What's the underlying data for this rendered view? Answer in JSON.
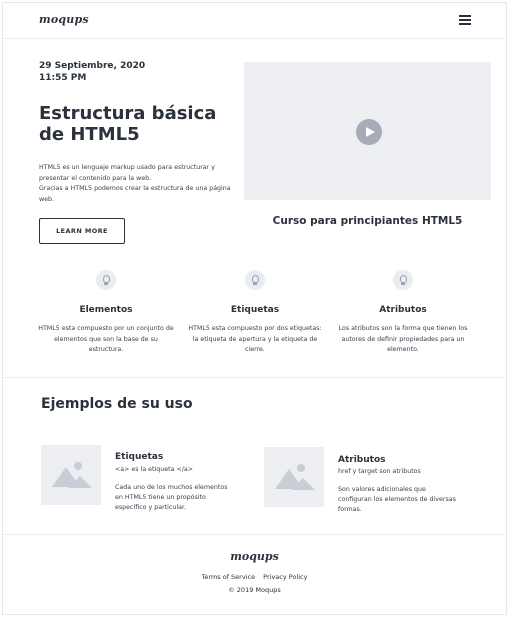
{
  "header": {
    "logo": "moqups",
    "menu_icon": "hamburger-icon"
  },
  "hero": {
    "date": "29 Septiembre, 2020",
    "time": "11:55 PM",
    "title": "Estructura básica de HTML5",
    "text_1": "HTML5 es un lenguaje markup usado para estructurar y presentar el contenido para la web.",
    "text_2": "Gracias a HTML5 podemos crear la estructura de una página web.",
    "button_label": "LEARN MORE"
  },
  "video": {
    "play_icon": "play-icon",
    "caption": "Curso para principiantes HTML5"
  },
  "features": [
    {
      "icon": "lightbulb-icon",
      "title": "Elementos",
      "text": "HTML5 esta compuesto por un conjunto de elementos que son la base de su estructura."
    },
    {
      "icon": "lightbulb-icon",
      "title": "Etiquetas",
      "text": "HTML5 esta compuesto por dos etiquetas: la etiqueta de apertura y la etiqueta de cierre."
    },
    {
      "icon": "lightbulb-icon",
      "title": "Atributos",
      "text": "Los atributos son la forma que tienen los autores de definir propiedades para un elemento."
    }
  ],
  "examples_section": {
    "title": "Ejemplos de su uso",
    "items": [
      {
        "icon": "image-placeholder-icon",
        "title": "Etiquetas",
        "subtitle": "<a> es la etiqueta </a>",
        "text": "Cada uno de los muchos elementos en HTML5 tiene un propósito específico y particular."
      },
      {
        "icon": "image-placeholder-icon",
        "title": "Atributos",
        "subtitle": "href y target son atributos",
        "text": "Son valores adicionales que configuran los elementos de diversas formas."
      }
    ]
  },
  "footer": {
    "logo": "moqups",
    "terms": "Terms of Service",
    "privacy": "Privacy Policy",
    "copyright": "© 2019   Moqups"
  }
}
